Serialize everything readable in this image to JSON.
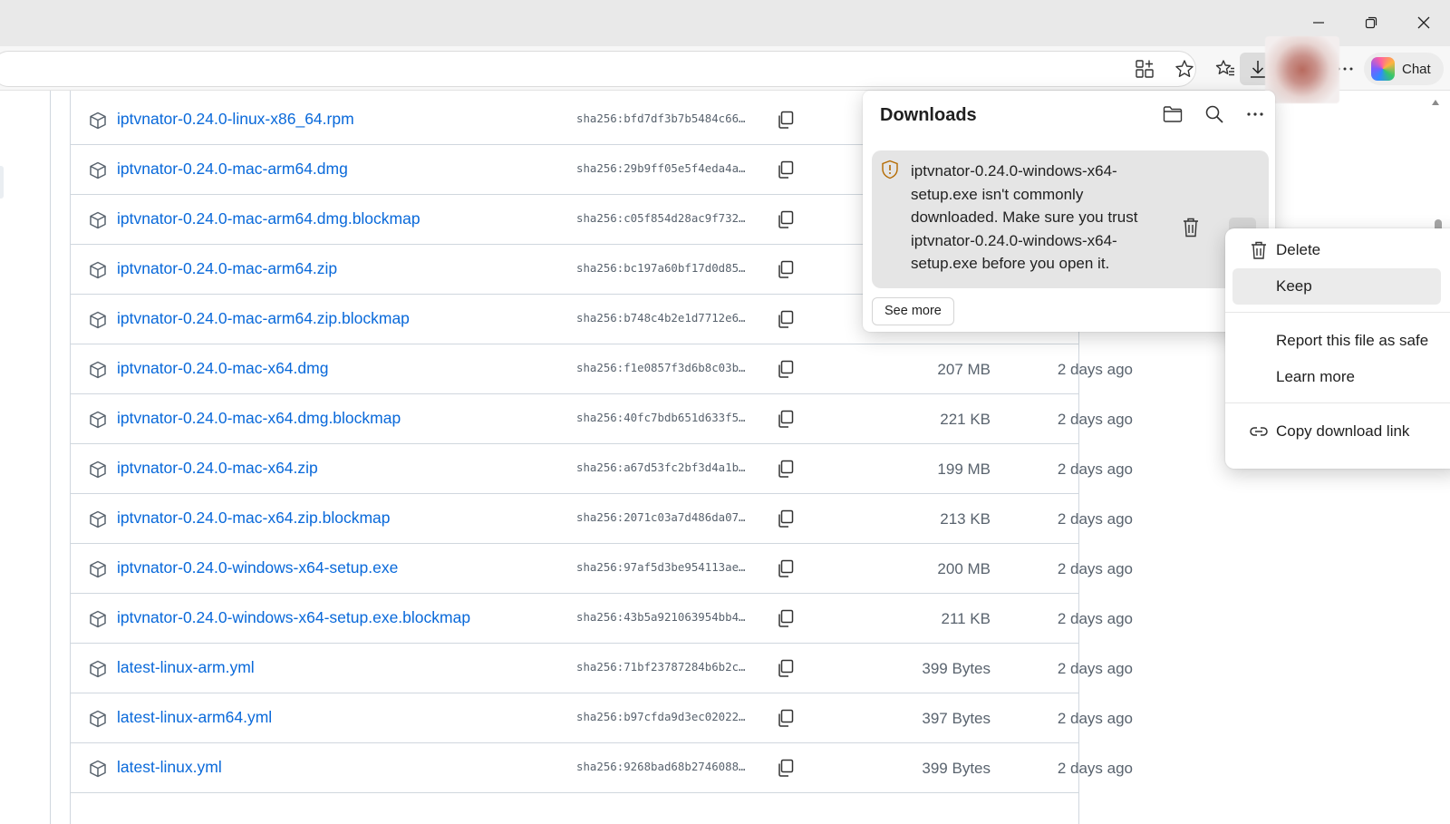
{
  "browser": {
    "tabs_strip": "",
    "toolbar": {
      "chat_label": "Chat"
    }
  },
  "assets": [
    {
      "name": "iptvnator-0.24.0-linux-x86_64.rpm",
      "sha": "sha256:bfd7df3b7b5484c66…",
      "size": "",
      "date": ""
    },
    {
      "name": "iptvnator-0.24.0-mac-arm64.dmg",
      "sha": "sha256:29b9ff05e5f4eda4a…",
      "size": "",
      "date": ""
    },
    {
      "name": "iptvnator-0.24.0-mac-arm64.dmg.blockmap",
      "sha": "sha256:c05f854d28ac9f732…",
      "size": "",
      "date": ""
    },
    {
      "name": "iptvnator-0.24.0-mac-arm64.zip",
      "sha": "sha256:bc197a60bf17d0d85…",
      "size": "",
      "date": ""
    },
    {
      "name": "iptvnator-0.24.0-mac-arm64.zip.blockmap",
      "sha": "sha256:b748c4b2e1d7712e6…",
      "size": "",
      "date": ""
    },
    {
      "name": "iptvnator-0.24.0-mac-x64.dmg",
      "sha": "sha256:f1e0857f3d6b8c03b…",
      "size": "207 MB",
      "date": "2 days ago"
    },
    {
      "name": "iptvnator-0.24.0-mac-x64.dmg.blockmap",
      "sha": "sha256:40fc7bdb651d633f5…",
      "size": "221 KB",
      "date": "2 days ago"
    },
    {
      "name": "iptvnator-0.24.0-mac-x64.zip",
      "sha": "sha256:a67d53fc2bf3d4a1b…",
      "size": "199 MB",
      "date": "2 days ago"
    },
    {
      "name": "iptvnator-0.24.0-mac-x64.zip.blockmap",
      "sha": "sha256:2071c03a7d486da07…",
      "size": "213 KB",
      "date": "2 days ago"
    },
    {
      "name": "iptvnator-0.24.0-windows-x64-setup.exe",
      "sha": "sha256:97af5d3be954113ae…",
      "size": "200 MB",
      "date": "2 days ago"
    },
    {
      "name": "iptvnator-0.24.0-windows-x64-setup.exe.blockmap",
      "sha": "sha256:43b5a921063954bb4…",
      "size": "211 KB",
      "date": "2 days ago"
    },
    {
      "name": "latest-linux-arm.yml",
      "sha": "sha256:71bf23787284b6b2c…",
      "size": "399 Bytes",
      "date": "2 days ago"
    },
    {
      "name": "latest-linux-arm64.yml",
      "sha": "sha256:b97cfda9d3ec02022…",
      "size": "397 Bytes",
      "date": "2 days ago"
    },
    {
      "name": "latest-linux.yml",
      "sha": "sha256:9268bad68b2746088…",
      "size": "399 Bytes",
      "date": "2 days ago"
    }
  ],
  "downloads": {
    "title": "Downloads",
    "warning": "iptvnator-0.24.0-windows-x64-setup.exe isn't commonly downloaded. Make sure you trust iptvnator-0.24.0-windows-x64-setup.exe before you open it.",
    "see_more": "See more"
  },
  "context_menu": {
    "delete": "Delete",
    "keep": "Keep",
    "report": "Report this file as safe",
    "learn_more": "Learn more",
    "copy_link": "Copy download link"
  },
  "icons": {
    "minimize": "minimize-icon",
    "restore": "restore-icon",
    "close": "close-icon",
    "apps": "apps-icon",
    "favorite": "star-icon",
    "favorites": "favorites-icon",
    "download": "download-icon",
    "more": "more-icon",
    "package": "package-icon",
    "copy": "copy-icon",
    "folder": "folder-icon",
    "search": "search-icon",
    "warning": "shield-warning-icon",
    "trash": "trash-icon",
    "link": "link-icon"
  },
  "colors": {
    "link": "#0969da",
    "muted": "#59636e",
    "warning": "#b46a00"
  }
}
